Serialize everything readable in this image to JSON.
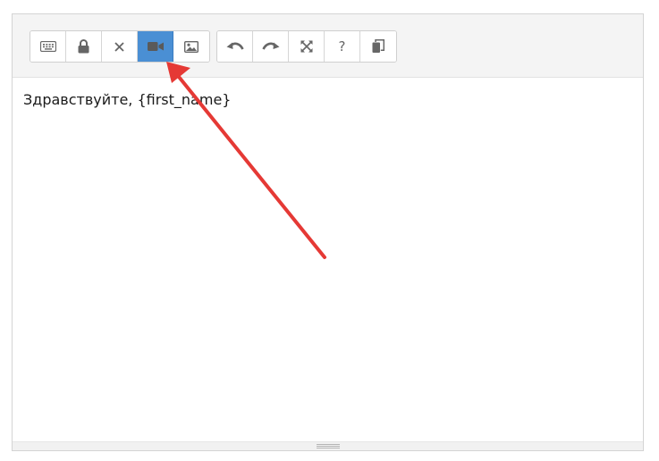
{
  "toolbar": {
    "group1": [
      {
        "name": "keyboard-icon",
        "title": "Keyboard"
      },
      {
        "name": "lock-icon",
        "title": "Lock"
      },
      {
        "name": "close-icon",
        "title": "Clear"
      },
      {
        "name": "video-icon",
        "title": "Video",
        "active": true
      },
      {
        "name": "image-icon",
        "title": "Image"
      }
    ],
    "group2": [
      {
        "name": "undo-icon",
        "title": "Undo"
      },
      {
        "name": "redo-icon",
        "title": "Redo"
      },
      {
        "name": "fullscreen-icon",
        "title": "Fullscreen"
      },
      {
        "name": "help-icon",
        "title": "Help",
        "label": "?"
      },
      {
        "name": "copy-icon",
        "title": "Copy"
      }
    ]
  },
  "editor": {
    "content": "Здравствуйте, {first_name}"
  },
  "colors": {
    "active_button": "#4a8fd4",
    "annotation_arrow": "#e53935"
  }
}
